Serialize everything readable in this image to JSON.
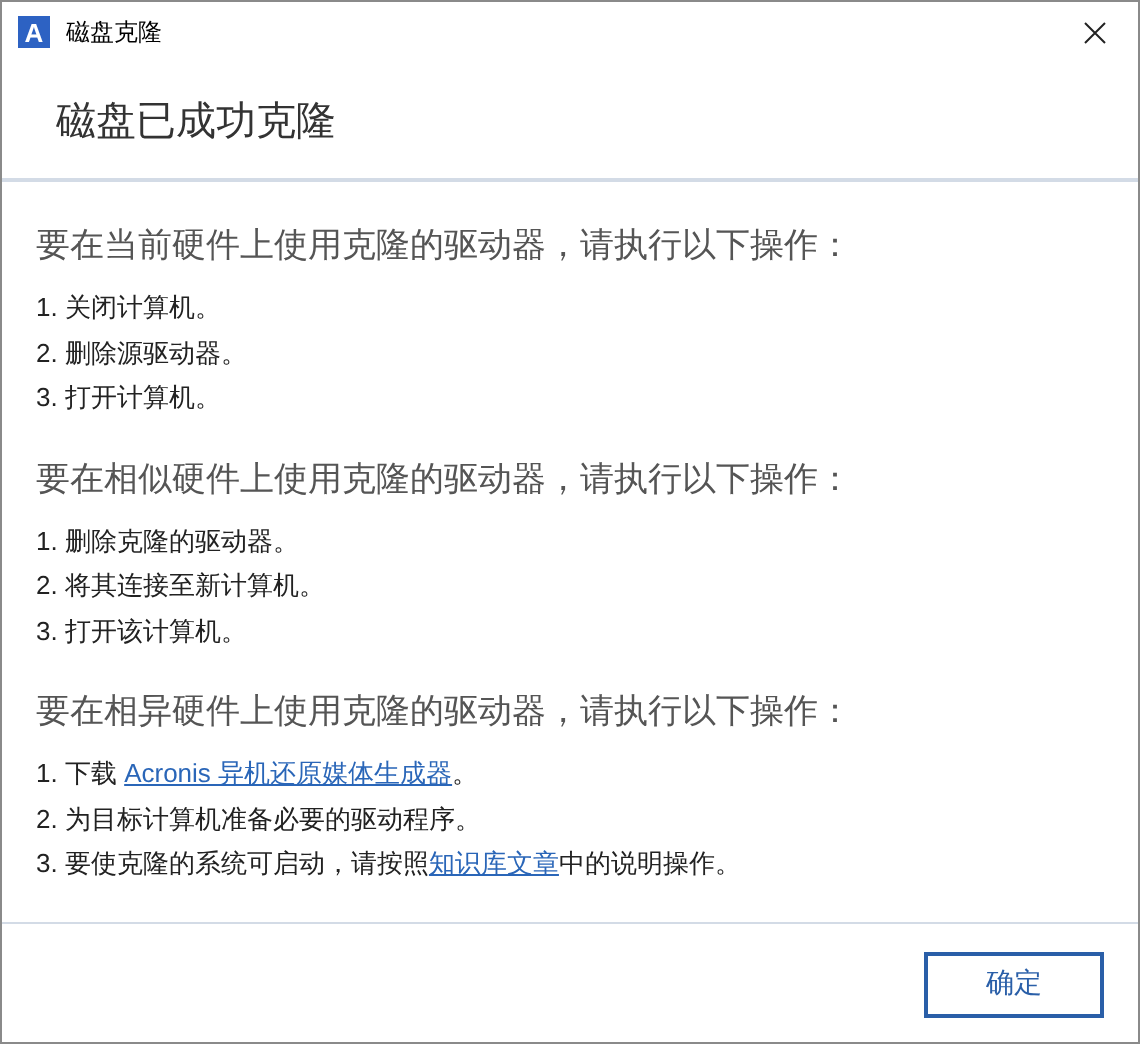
{
  "window": {
    "title": "磁盘克隆",
    "app_icon": "A"
  },
  "header": {
    "title": "磁盘已成功克隆"
  },
  "sections": [
    {
      "heading": "要在当前硬件上使用克隆的驱动器，请执行以下操作：",
      "steps": [
        [
          {
            "kind": "text",
            "text": "1. 关闭计算机。"
          }
        ],
        [
          {
            "kind": "text",
            "text": "2. 删除源驱动器。"
          }
        ],
        [
          {
            "kind": "text",
            "text": "3. 打开计算机。"
          }
        ]
      ]
    },
    {
      "heading": "要在相似硬件上使用克隆的驱动器，请执行以下操作：",
      "steps": [
        [
          {
            "kind": "text",
            "text": "1. 删除克隆的驱动器。"
          }
        ],
        [
          {
            "kind": "text",
            "text": "2. 将其连接至新计算机。"
          }
        ],
        [
          {
            "kind": "text",
            "text": "3. 打开该计算机。"
          }
        ]
      ]
    },
    {
      "heading": "要在相异硬件上使用克隆的驱动器，请执行以下操作：",
      "steps": [
        [
          {
            "kind": "text",
            "text": "1. 下载 "
          },
          {
            "kind": "link",
            "text": "Acronis 异机还原媒体生成器"
          },
          {
            "kind": "text",
            "text": "。"
          }
        ],
        [
          {
            "kind": "text",
            "text": "2. 为目标计算机准备必要的驱动程序。"
          }
        ],
        [
          {
            "kind": "text",
            "text": "3. 要使克隆的系统可启动，请按照"
          },
          {
            "kind": "link",
            "text": "知识库文章"
          },
          {
            "kind": "text",
            "text": "中的说明操作。"
          }
        ]
      ]
    }
  ],
  "buttons": [
    "确定"
  ]
}
